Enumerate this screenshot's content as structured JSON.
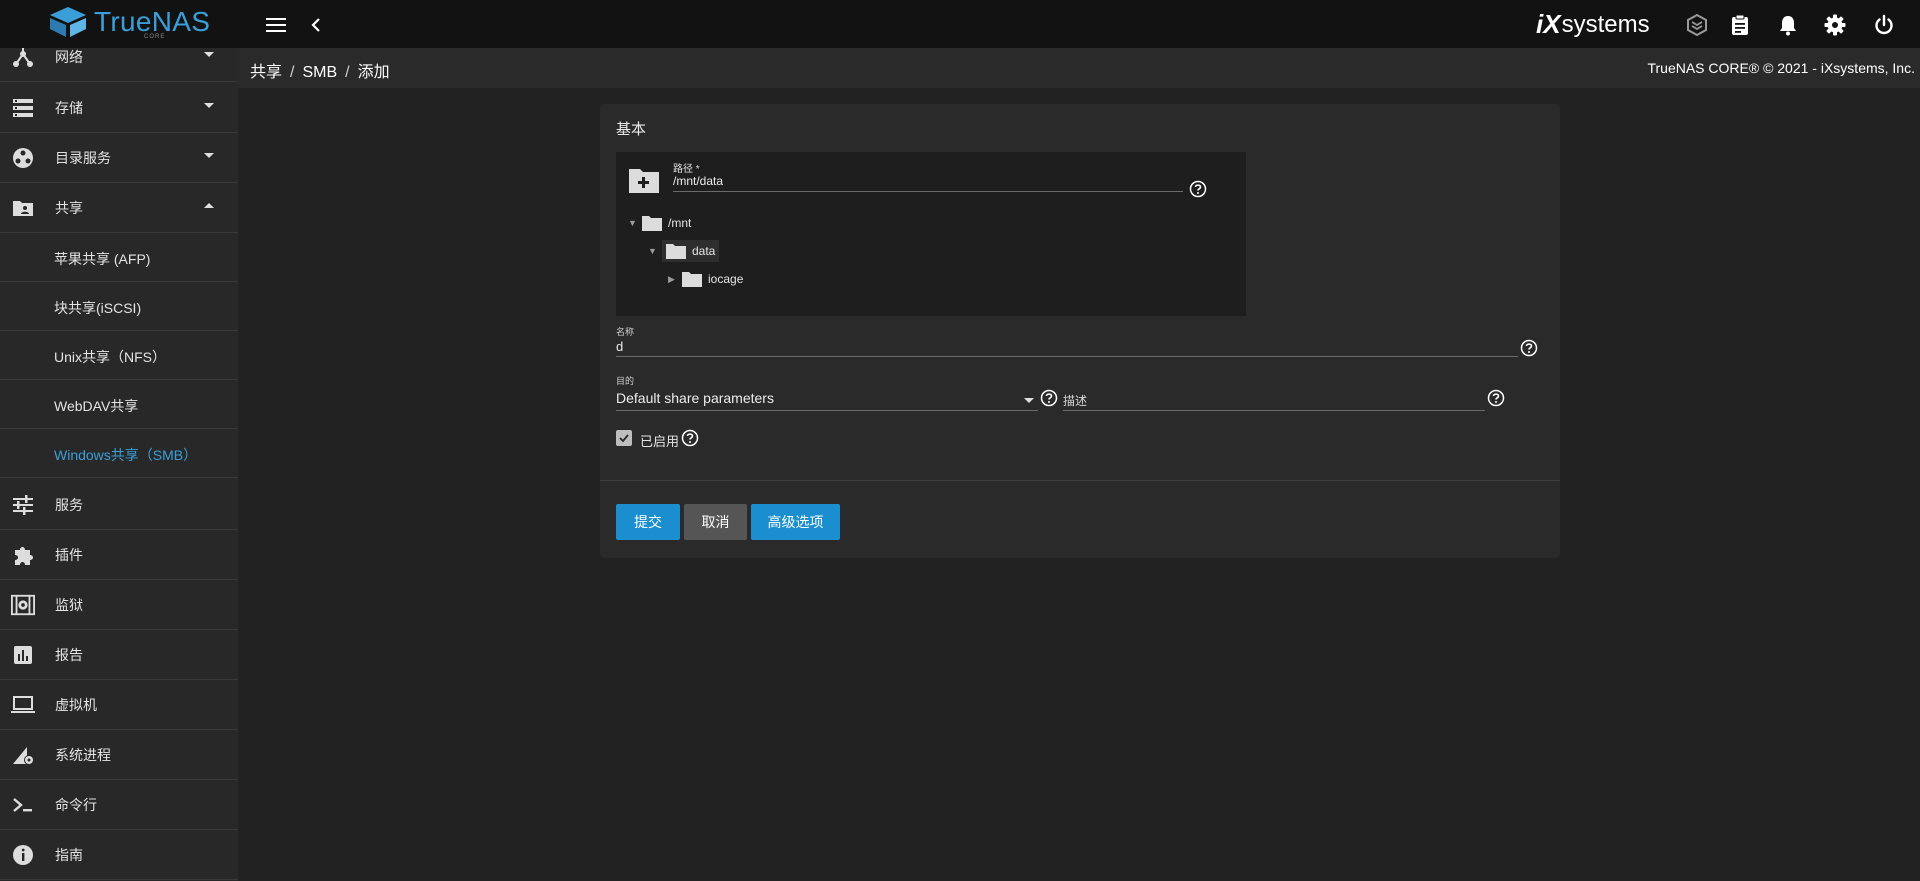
{
  "app": {
    "name": "TrueNAS",
    "edition": "CORE",
    "vendor_logo_i": "iX",
    "vendor_logo_rest": "systems"
  },
  "breadcrumb": {
    "items": [
      "共享",
      "SMB",
      "添加"
    ],
    "separator": "/"
  },
  "copyright": "TrueNAS CORE® © 2021 - iXsystems, Inc.",
  "sidebar": {
    "items": [
      {
        "label": "网络",
        "icon": "network-icon",
        "expandable": true,
        "expanded": false
      },
      {
        "label": "存储",
        "icon": "storage-icon",
        "expandable": true,
        "expanded": false
      },
      {
        "label": "目录服务",
        "icon": "directory-services-icon",
        "expandable": true,
        "expanded": false
      },
      {
        "label": "共享",
        "icon": "sharing-icon",
        "expandable": true,
        "expanded": true,
        "active": true
      },
      {
        "label": "服务",
        "icon": "services-icon"
      },
      {
        "label": "插件",
        "icon": "plugins-icon"
      },
      {
        "label": "监狱",
        "icon": "jails-icon"
      },
      {
        "label": "报告",
        "icon": "reporting-icon"
      },
      {
        "label": "虚拟机",
        "icon": "virtual-machines-icon"
      },
      {
        "label": "系统进程",
        "icon": "system-processes-icon"
      },
      {
        "label": "命令行",
        "icon": "shell-icon"
      },
      {
        "label": "指南",
        "icon": "guide-icon"
      }
    ],
    "sub_items": [
      {
        "label": "苹果共享 (AFP)"
      },
      {
        "label": "块共享(iSCSI)"
      },
      {
        "label": "Unix共享（NFS）"
      },
      {
        "label": "WebDAV共享"
      },
      {
        "label": "Windows共享（SMB）",
        "active": true
      }
    ]
  },
  "form": {
    "section_title": "基本",
    "path": {
      "label": "路径 *",
      "value": "/mnt/data",
      "tree": [
        {
          "name": "/mnt",
          "expanded": true,
          "level": 0
        },
        {
          "name": "data",
          "expanded": true,
          "level": 1,
          "selected": true
        },
        {
          "name": "iocage",
          "expanded": false,
          "level": 2
        }
      ]
    },
    "name": {
      "label": "名称",
      "value": "d"
    },
    "purpose": {
      "label": "目的",
      "value": "Default share parameters"
    },
    "description": {
      "label": "描述",
      "value": ""
    },
    "enabled": {
      "label": "已启用",
      "checked": true
    },
    "buttons": {
      "submit": "提交",
      "cancel": "取消",
      "advanced": "高级选项"
    }
  },
  "colors": {
    "accent": "#1b8ed0",
    "topbar": "#121212",
    "sidebar": "#282828",
    "background": "#222222",
    "card": "#2a2a2a"
  }
}
